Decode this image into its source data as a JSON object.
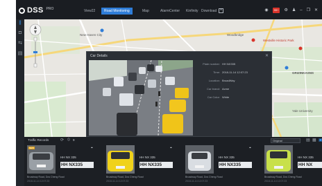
{
  "app": {
    "brand": "DSS",
    "brand_sup": "PRO"
  },
  "tabs": [
    {
      "label": "View22",
      "active": false
    },
    {
      "label": "Road Monitoring",
      "active": true
    },
    {
      "label": "Map",
      "active": false
    },
    {
      "label": "AlarmCenter",
      "active": false
    },
    {
      "label": "Kinfinity",
      "active": false
    },
    {
      "label": "Download",
      "active": false
    }
  ],
  "top_icons": {
    "alarm_badge": "99+"
  },
  "map": {
    "labels": [
      {
        "text": "New Haven City"
      },
      {
        "text": "Westville Historic Park"
      },
      {
        "text": "Woodbridge"
      },
      {
        "text": "GRIZINKASNS"
      },
      {
        "text": "Yale University"
      }
    ]
  },
  "dialog": {
    "title": "Car Details",
    "rows": [
      {
        "key": "Plate number:",
        "value": "HH NX335"
      },
      {
        "key": "Time:",
        "value": "2018-11-14 12:07:23"
      },
      {
        "key": "Location:",
        "value": "BroadWay"
      },
      {
        "key": "Car brand:",
        "value": "Acme"
      },
      {
        "key": "Car Color:",
        "value": "White"
      }
    ]
  },
  "bottom": {
    "title": "Traffic Records",
    "count": "9",
    "select_value": "Original",
    "cards": [
      {
        "plate_label": "HH NX 335",
        "plate": "HH NX335",
        "loc": "Broadway Road, Dos Cheng Road",
        "time": "2018-11-14 12:07:23",
        "new": "NEW",
        "car_color": "#9aa0a6"
      },
      {
        "plate_label": "HH NX 335",
        "plate": "HH NX335",
        "loc": "Broadway Road, Dos Cheng Road",
        "time": "2018-11-14 12:07:23",
        "new": "",
        "car_color": "#f0d21a"
      },
      {
        "plate_label": "HH NX 335",
        "plate": "HH NX335",
        "loc": "Broadway Road, Dos Cheng Road",
        "time": "2018-11-14 12:07:23",
        "new": "",
        "car_color": "#d9dde2"
      },
      {
        "plate_label": "HH NX 335",
        "plate": "HH NX",
        "loc": "Broadway Road, Dos Cheng Road",
        "time": "2018-11-14 12:07:23",
        "new": "",
        "car_color": "#c8e04a"
      }
    ]
  }
}
